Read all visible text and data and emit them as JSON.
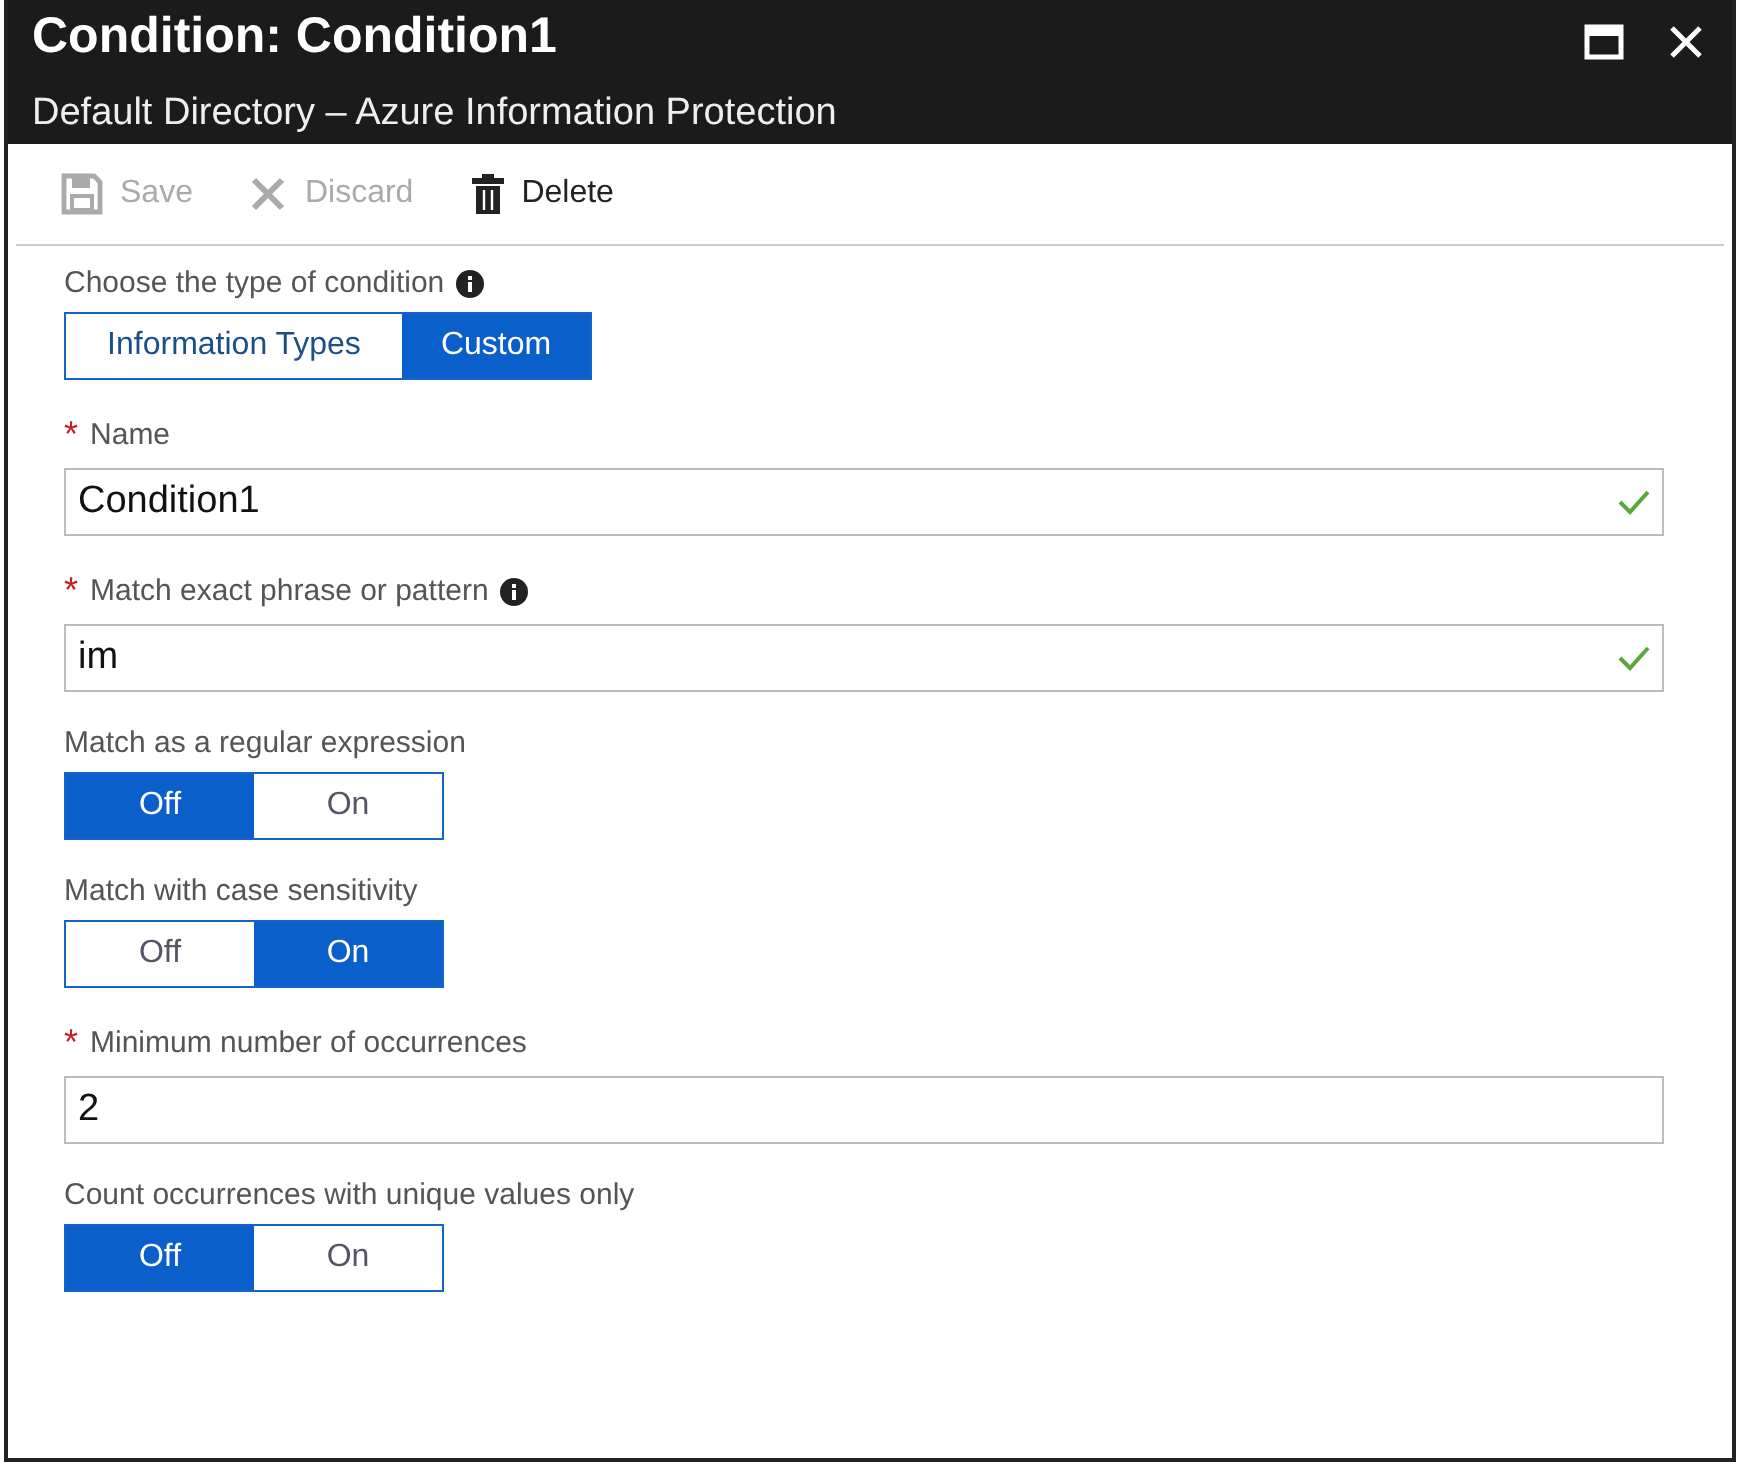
{
  "window": {
    "title": "Condition: Condition1",
    "subtitle": "Default Directory – Azure Information Protection"
  },
  "toolbar": [
    {
      "kind": "save",
      "label": "Save",
      "disabled": true
    },
    {
      "kind": "discard",
      "label": "Discard",
      "disabled": true
    },
    {
      "kind": "delete",
      "label": "Delete",
      "disabled": false
    }
  ],
  "fields": [
    {
      "kind": "segmented",
      "label": "Choose the type of condition",
      "info": true,
      "options": [
        {
          "label": "Information Types",
          "selected": false
        },
        {
          "label": "Custom",
          "selected": true
        }
      ]
    },
    {
      "kind": "text",
      "required_mark": "*",
      "label": "Name",
      "info": false,
      "value": "Condition1",
      "valid": true
    },
    {
      "kind": "text",
      "required_mark": "*",
      "label": "Match exact phrase or pattern",
      "info": true,
      "value": "im",
      "valid": true
    },
    {
      "kind": "segmented",
      "label": "Match as a regular expression",
      "info": false,
      "options": [
        {
          "label": "Off",
          "selected": true
        },
        {
          "label": "On",
          "selected": false
        }
      ]
    },
    {
      "kind": "segmented",
      "label": "Match with case sensitivity",
      "info": false,
      "options": [
        {
          "label": "Off",
          "selected": false
        },
        {
          "label": "On",
          "selected": true
        }
      ]
    },
    {
      "kind": "text",
      "required_mark": "*",
      "label": "Minimum number of occurrences",
      "info": false,
      "value": "2",
      "valid": false
    },
    {
      "kind": "segmented",
      "label": "Count occurrences with unique values only",
      "info": false,
      "options": [
        {
          "label": "Off",
          "selected": true
        },
        {
          "label": "On",
          "selected": false
        }
      ]
    }
  ]
}
